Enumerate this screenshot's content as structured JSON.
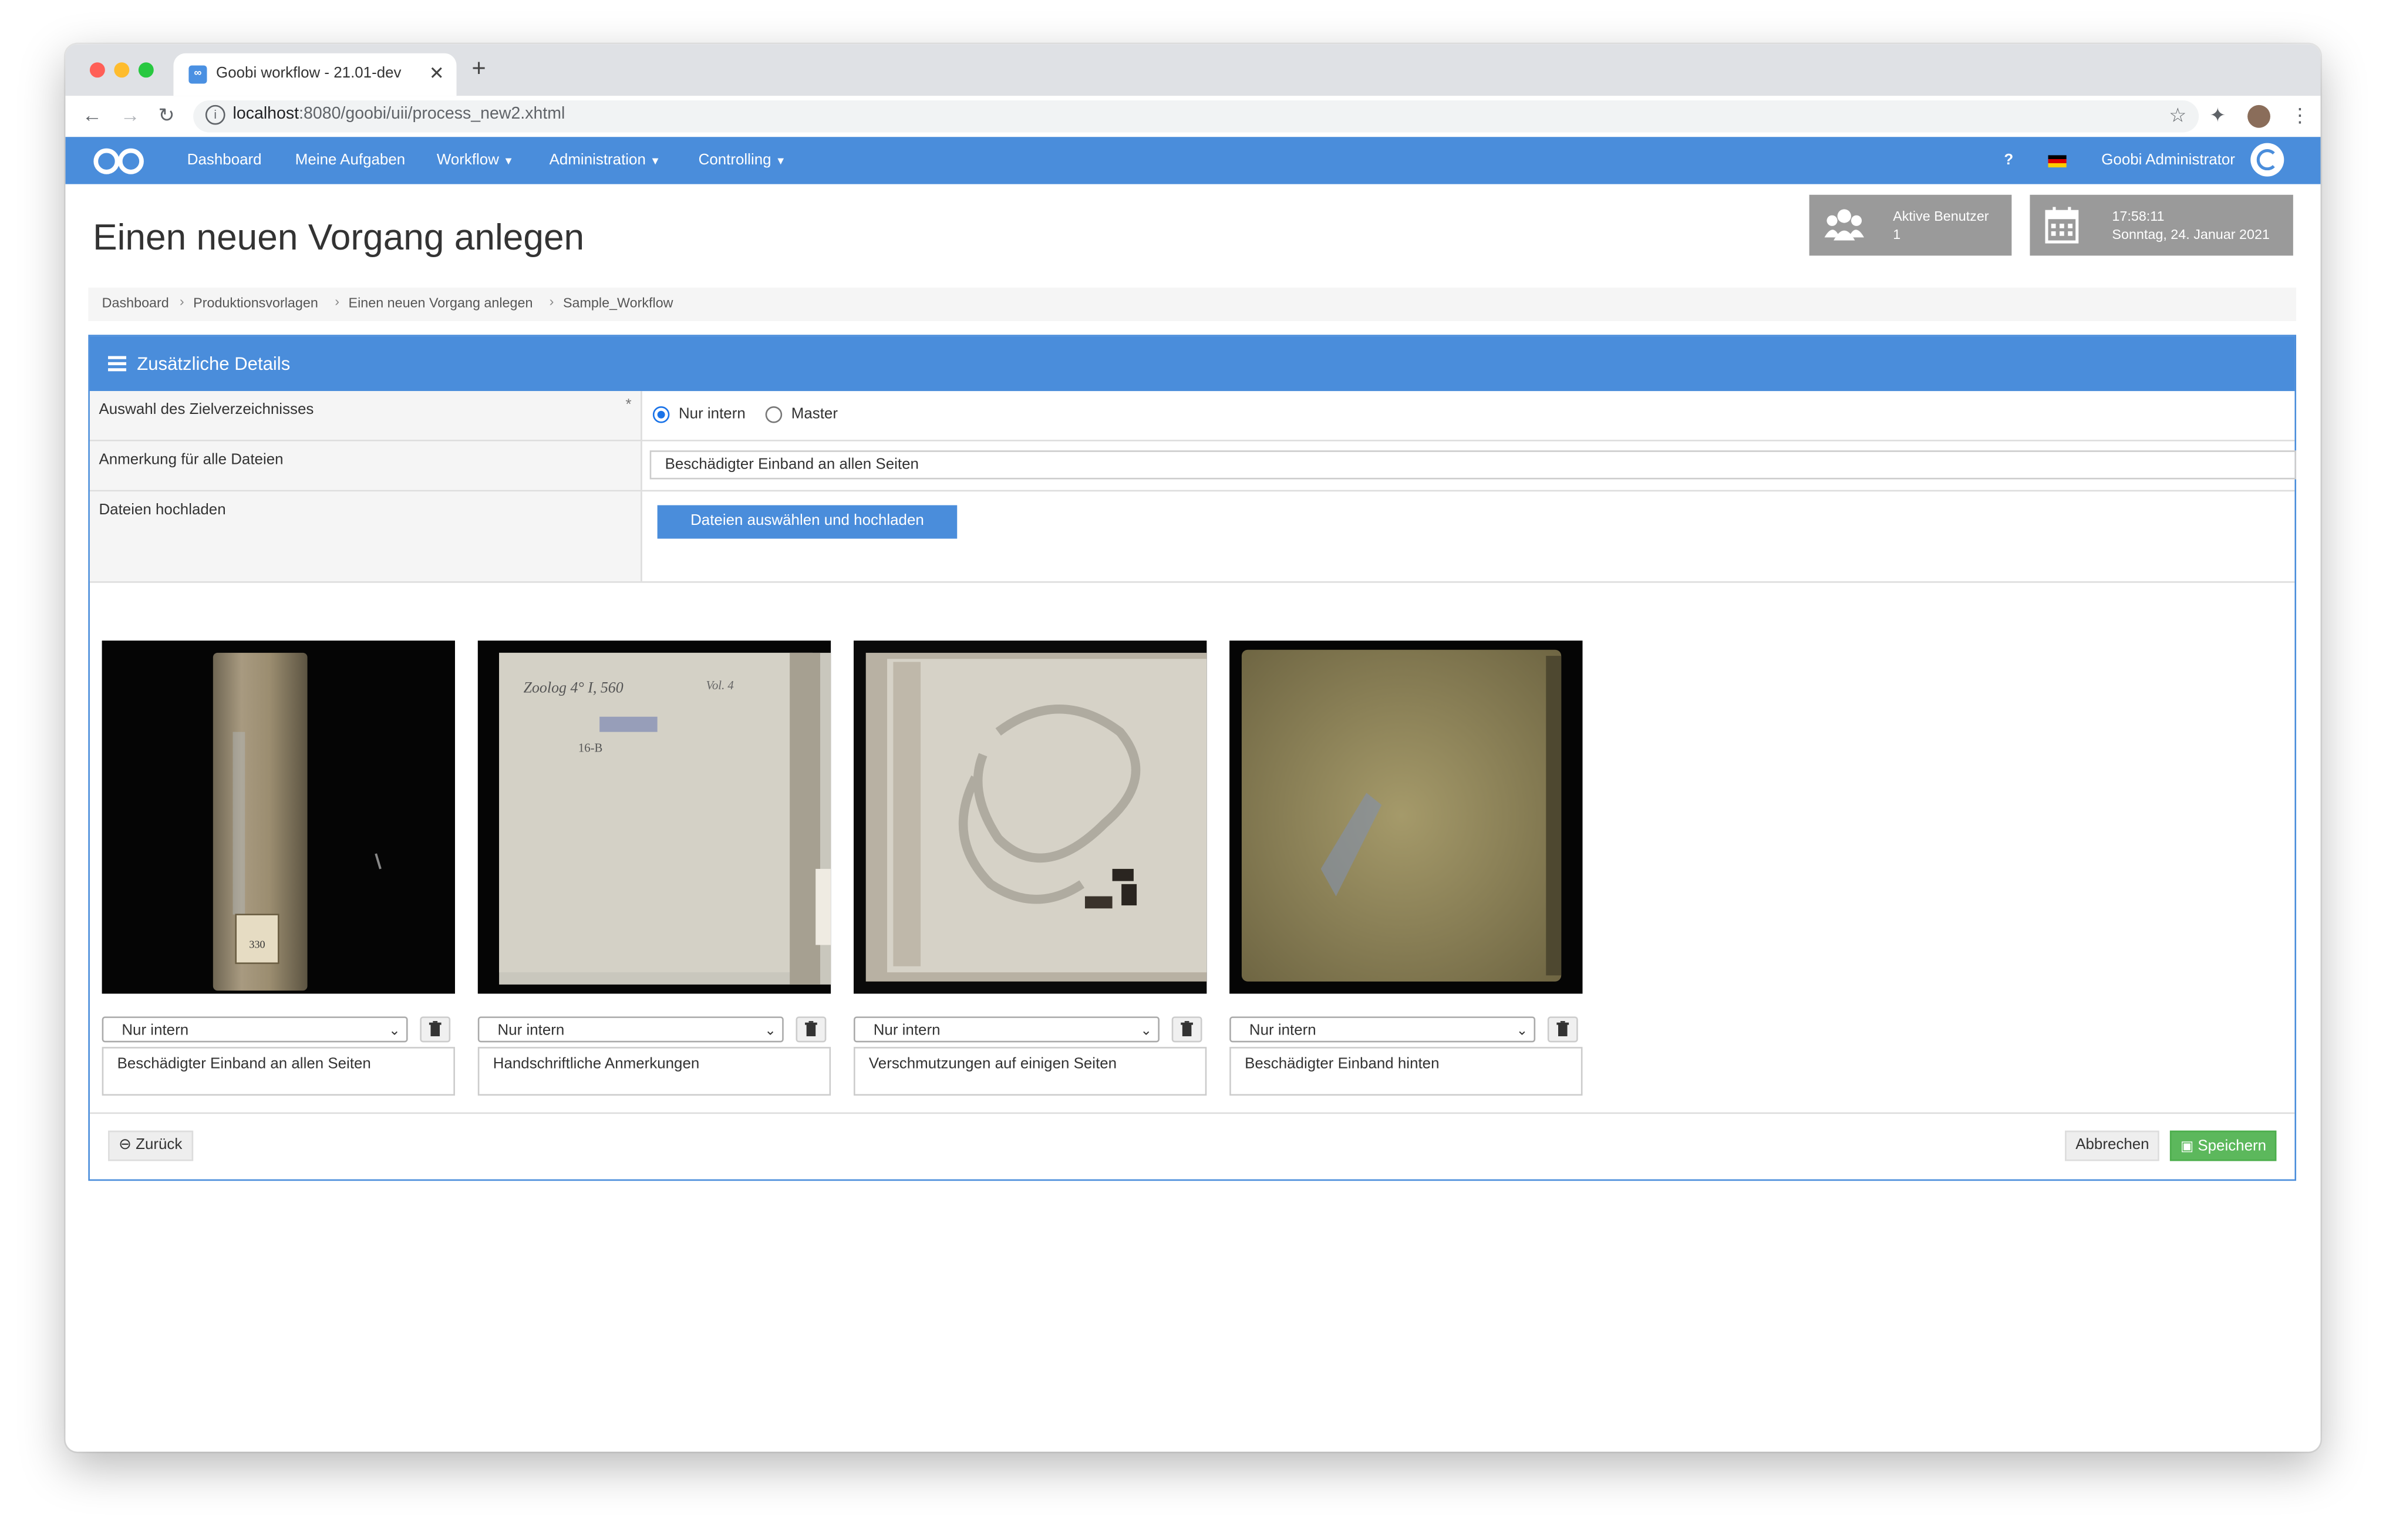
{
  "browser": {
    "tab_title": "Goobi workflow - 21.01-dev",
    "tab_favicon": "∞",
    "url_host": "localhost",
    "url_rest": ":8080/goobi/uii/process_new2.xhtml"
  },
  "navbar": {
    "items": [
      "Dashboard",
      "Meine Aufgaben",
      "Workflow",
      "Administration",
      "Controlling"
    ],
    "help": "?",
    "user": "Goobi Administrator"
  },
  "header": {
    "title": "Einen neuen Vorgang anlegen",
    "active_users_label": "Aktive Benutzer",
    "active_users_count": "1",
    "time": "17:58:11",
    "date": "Sonntag, 24. Januar 2021"
  },
  "breadcrumb": [
    "Dashboard",
    "Produktionsvorlagen",
    "Einen neuen Vorgang anlegen",
    "Sample_Workflow"
  ],
  "panel": {
    "title": "Zusätzliche Details",
    "target_label": "Auswahl des Zielverzeichnisses",
    "required_mark": "*",
    "radio_internal": "Nur intern",
    "radio_master": "Master",
    "note_all_label": "Anmerkung für alle Dateien",
    "note_all_value": "Beschädigter Einband an allen Seiten",
    "upload_label": "Dateien hochladen",
    "upload_button": "Dateien auswählen und hochladen"
  },
  "files": [
    {
      "select": "Nur intern",
      "note": "Beschädigter Einband an allen Seiten"
    },
    {
      "select": "Nur intern",
      "note": "Handschriftliche Anmerkungen"
    },
    {
      "select": "Nur intern",
      "note": "Verschmutzungen auf einigen Seiten"
    },
    {
      "select": "Nur intern",
      "note": "Beschädigter Einband hinten"
    }
  ],
  "thumb_text": {
    "spine_label": "330",
    "cover_sig": "Zoolog 4° I, 560",
    "cover_vol": "Vol. 4",
    "cover_num": "16-B"
  },
  "buttons": {
    "back": "Zurück",
    "cancel": "Abbrechen",
    "save": "Speichern"
  },
  "colors": {
    "brand_blue": "#4a8ddb",
    "save_green": "#5cb85c"
  }
}
